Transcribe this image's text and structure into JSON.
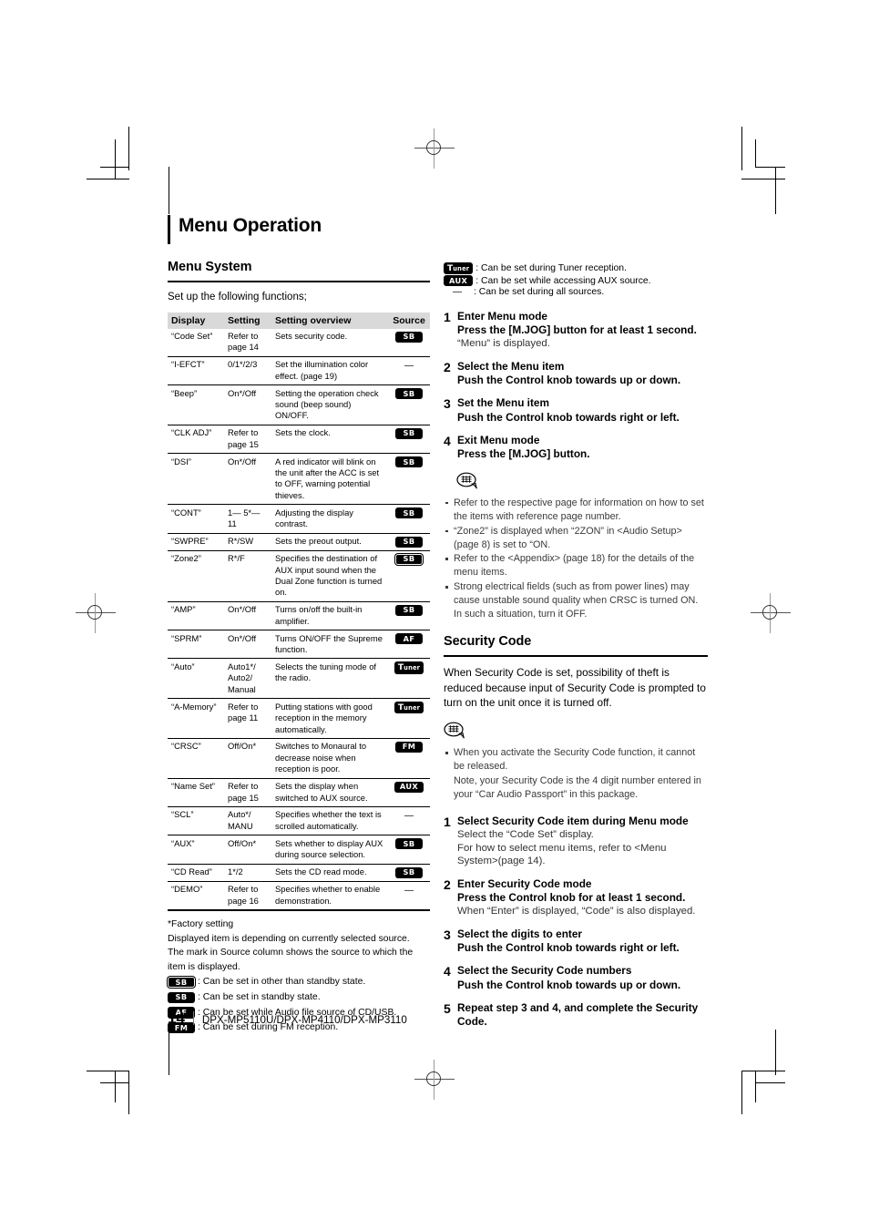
{
  "page": {
    "title": "Menu Operation",
    "footer": {
      "page_number": "14",
      "models": "DPX-MP5110U/DPX-MP4110/DPX-MP3110"
    }
  },
  "menu_system": {
    "heading": "Menu System",
    "intro": "Set up the following functions;",
    "table": {
      "headers": [
        "Display",
        "Setting",
        "Setting overview",
        "Source"
      ],
      "rows": [
        {
          "display": "“Code Set”",
          "setting": "Refer to page 14",
          "overview": "Sets security code.",
          "source": "SB",
          "source_style": "solid"
        },
        {
          "display": "“I-EFCT”",
          "setting": "0/1*/2/3",
          "overview": "Set the illumination color effect. (page 19)",
          "source": "—",
          "source_style": "dash"
        },
        {
          "display": "“Beep”",
          "setting": "On*/Off",
          "overview": "Setting the operation check sound (beep sound) ON/OFF.",
          "source": "SB",
          "source_style": "solid"
        },
        {
          "display": "“CLK ADJ”",
          "setting": "Refer to page 15",
          "overview": "Sets the clock.",
          "source": "SB",
          "source_style": "solid"
        },
        {
          "display": "“DSI”",
          "setting": "On*/Off",
          "overview": "A red indicator will blink on the unit after the ACC is set to OFF, warning potential thieves.",
          "source": "SB",
          "source_style": "solid"
        },
        {
          "display": "“CONT”",
          "setting": "1— 5*— 11",
          "overview": "Adjusting the display contrast.",
          "source": "SB",
          "source_style": "solid"
        },
        {
          "display": "“SWPRE”",
          "setting": "R*/SW",
          "overview": "Sets the preout output.",
          "source": "SB",
          "source_style": "solid"
        },
        {
          "display": "“Zone2”",
          "setting": "R*/F",
          "overview": "Specifies the destination of AUX input sound when the Dual Zone function is turned on.",
          "source": "SB",
          "source_style": "outlined"
        },
        {
          "display": "“AMP”",
          "setting": "On*/Off",
          "overview": "Turns on/off the built-in amplifier.",
          "source": "SB",
          "source_style": "solid"
        },
        {
          "display": "“SPRM”",
          "setting": "On*/Off",
          "overview": "Turns ON/OFF the Supreme function.",
          "source": "AF",
          "source_style": "solid"
        },
        {
          "display": "“Auto”",
          "setting": "Auto1*/ Auto2/ Manual",
          "overview": "Selects the tuning mode of the radio.",
          "source": "Tuner",
          "source_style": "tuner"
        },
        {
          "display": "“A-Memory”",
          "setting": "Refer to page 11",
          "overview": "Putting stations with good reception in the memory automatically.",
          "source": "Tuner",
          "source_style": "tuner"
        },
        {
          "display": "“CRSC”",
          "setting": "Off/On*",
          "overview": "Switches to Monaural to decrease noise when reception is poor.",
          "source": "FM",
          "source_style": "solid"
        },
        {
          "display": "“Name Set”",
          "setting": "Refer to page 15",
          "overview": "Sets the display when switched to AUX source.",
          "source": "AUX",
          "source_style": "solid"
        },
        {
          "display": "“SCL”",
          "setting": "Auto*/ MANU",
          "overview": "Specifies whether the text is scrolled automatically.",
          "source": "—",
          "source_style": "dash"
        },
        {
          "display": "“AUX”",
          "setting": "Off/On*",
          "overview": "Sets whether to display AUX during source selection.",
          "source": "SB",
          "source_style": "solid"
        },
        {
          "display": "“CD Read”",
          "setting": "1*/2",
          "overview": "Sets the CD read mode.",
          "source": "SB",
          "source_style": "solid"
        },
        {
          "display": "“DEMO”",
          "setting": "Refer to page 16",
          "overview": "Specifies whether to enable demonstration.",
          "source": "—",
          "source_style": "dash"
        }
      ]
    },
    "footnotes": {
      "factory": "*Factory setting",
      "line1": "Displayed item is depending on currently selected source.",
      "line2": "The mark in Source column shows the source to which the item is displayed.",
      "legend": [
        {
          "badge": "SB",
          "style": "outlined",
          "text": ": Can be set in other than standby state."
        },
        {
          "badge": "SB",
          "style": "solid",
          "text": ": Can be set in standby state."
        },
        {
          "badge": "AF",
          "style": "solid",
          "text": ": Can be set while Audio file source of CD/USB."
        },
        {
          "badge": "FM",
          "style": "solid",
          "text": ": Can be set during FM reception."
        }
      ]
    }
  },
  "right_column": {
    "source_legend": [
      {
        "badge": "Tuner",
        "style": "tuner",
        "text": ": Can be set during Tuner reception."
      },
      {
        "badge": "AUX",
        "style": "solid",
        "text": ": Can be set while accessing AUX source."
      },
      {
        "badge": "—",
        "style": "dash",
        "text": ": Can be set during all sources."
      }
    ],
    "steps": [
      {
        "num": "1",
        "title": "Enter Menu mode",
        "sub": "Press the [M.JOG] button for at least 1 second.",
        "note": "“Menu” is displayed."
      },
      {
        "num": "2",
        "title": "Select the Menu item",
        "sub": "Push the Control knob towards up or down.",
        "note": ""
      },
      {
        "num": "3",
        "title": "Set the Menu item",
        "sub": "Push the Control knob towards right or left.",
        "note": ""
      },
      {
        "num": "4",
        "title": "Exit Menu mode",
        "sub": "Press the [M.JOG] button.",
        "note": ""
      }
    ],
    "notes": [
      "Refer to the respective page for information on how to set the items with reference page number.",
      "“Zone2” is displayed when “2ZON” in <Audio Setup> (page 8) is set to “ON.",
      "Refer to the <Appendix> (page 18) for the details of the menu items.",
      "Strong electrical fields (such as from power lines) may cause unstable sound quality when CRSC is turned ON. In such a situation, turn it OFF."
    ],
    "security": {
      "heading": "Security Code",
      "paragraph": "When Security Code is set, possibility of theft is reduced because input of Security Code is prompted to turn on the unit once it is turned off.",
      "notes": [
        "When you activate the Security Code function, it cannot be released.",
        "Note, your Security Code is the 4 digit number entered in your “Car Audio Passport” in this package."
      ],
      "steps": [
        {
          "num": "1",
          "title": "Select Security Code item during Menu mode",
          "sub": "",
          "note": "Select the “Code Set” display.\nFor how to select menu items, refer to <Menu System>(page 14)."
        },
        {
          "num": "2",
          "title": "Enter Security Code mode",
          "sub": "Press the Control knob for at least 1 second.",
          "note": "When “Enter” is displayed, “Code” is also displayed."
        },
        {
          "num": "3",
          "title": "Select the digits to enter",
          "sub": "Push the Control knob towards right or left.",
          "note": ""
        },
        {
          "num": "4",
          "title": "Select the Security Code numbers",
          "sub": "Push the Control knob towards up or down.",
          "note": ""
        },
        {
          "num": "5",
          "title": "Repeat step 3 and 4, and complete the Security Code.",
          "sub": "",
          "note": ""
        }
      ]
    }
  }
}
